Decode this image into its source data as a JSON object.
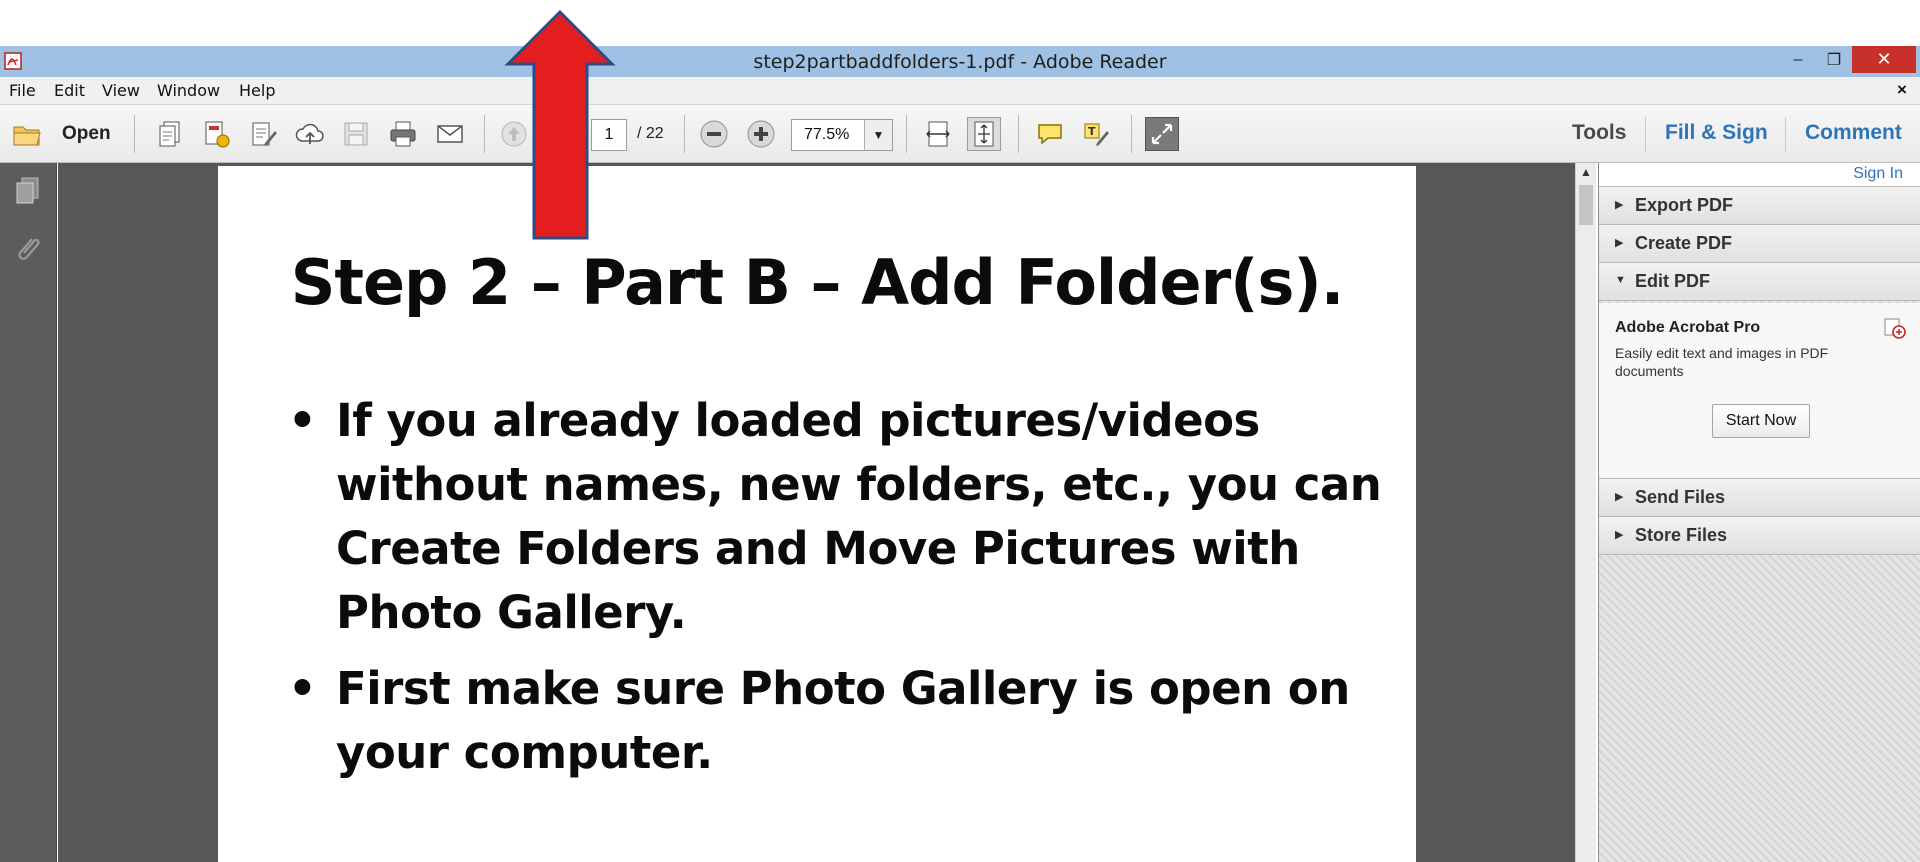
{
  "window": {
    "title": "step2partbaddfolders-1.pdf - Adobe Reader",
    "min_glyph": "–",
    "max_glyph": "❐",
    "close_glyph": "✕"
  },
  "menu": {
    "items": [
      "File",
      "Edit",
      "View",
      "Window",
      "Help"
    ],
    "close_doc": "×"
  },
  "toolbar": {
    "open_label": "Open",
    "page_current": "1",
    "page_total": "/ 22",
    "zoom": "77.5%",
    "tools_label": "Tools",
    "fill_sign_label": "Fill & Sign",
    "comment_label": "Comment"
  },
  "document": {
    "title": "Step 2 – Part B – Add Folder(s).",
    "bullet_char": "•",
    "bullets": [
      "If you already loaded pictures/videos without names, new folders, etc., you can Create Folders and Move Pictures with Photo Gallery.",
      "First make sure Photo Gallery is open on your computer."
    ]
  },
  "right_panel": {
    "sign_in": "Sign In",
    "sections": [
      {
        "label": "Export PDF",
        "expanded": false
      },
      {
        "label": "Create PDF",
        "expanded": false
      },
      {
        "label": "Edit PDF",
        "expanded": true
      },
      {
        "label": "Send Files",
        "expanded": false
      },
      {
        "label": "Store Files",
        "expanded": false
      }
    ],
    "arrow_collapsed": "▶",
    "arrow_expanded": "▼",
    "edit_pdf": {
      "product": "Adobe Acrobat Pro",
      "description": "Easily edit text and images in PDF documents",
      "button": "Start Now"
    }
  },
  "colors": {
    "titlebar": "#9fc2e4",
    "close_button": "#c7302b",
    "link_blue": "#2f73b8",
    "annotation_arrow": "#e41e1e"
  }
}
